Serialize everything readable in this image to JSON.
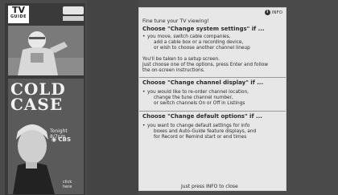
{
  "guide": {
    "logo_top": "TV",
    "logo_bottom": "GUIDE",
    "channel_badge": "",
    "ad": {
      "title_line1": "COLD",
      "title_line2": "CASE",
      "time": "Tonight 8/7pm",
      "network": "CBS",
      "click_line1": "click",
      "click_line2": "here"
    }
  },
  "panel": {
    "info_label": "INFO",
    "intro": "Fine tune your TV viewing!",
    "sections": [
      {
        "heading": "Choose \"Change system settings\" if ...",
        "bullet_lines": [
          "you move, switch cable companies,",
          "add a cable box or a recording device,",
          "or wish to choose another channel lineup"
        ],
        "after_lines": [
          "You'll be taken to a setup screen.",
          "Just choose one of the options, press Enter and follow",
          "the on-screen instructions."
        ]
      },
      {
        "heading": "Choose \"Change channel display\" if ...",
        "bullet_lines": [
          "you would like to re-order channel location,",
          "change the tune channel number,",
          "or switch channels On or Off in Listings"
        ]
      },
      {
        "heading": "Choose \"Change default options\" if ...",
        "bullet_lines": [
          "you want to change default settings for info",
          "boxes and Auto-Guide feature displays, and",
          "for Record or Remind start or end times"
        ]
      }
    ],
    "footer": "Just press INFO to close"
  }
}
